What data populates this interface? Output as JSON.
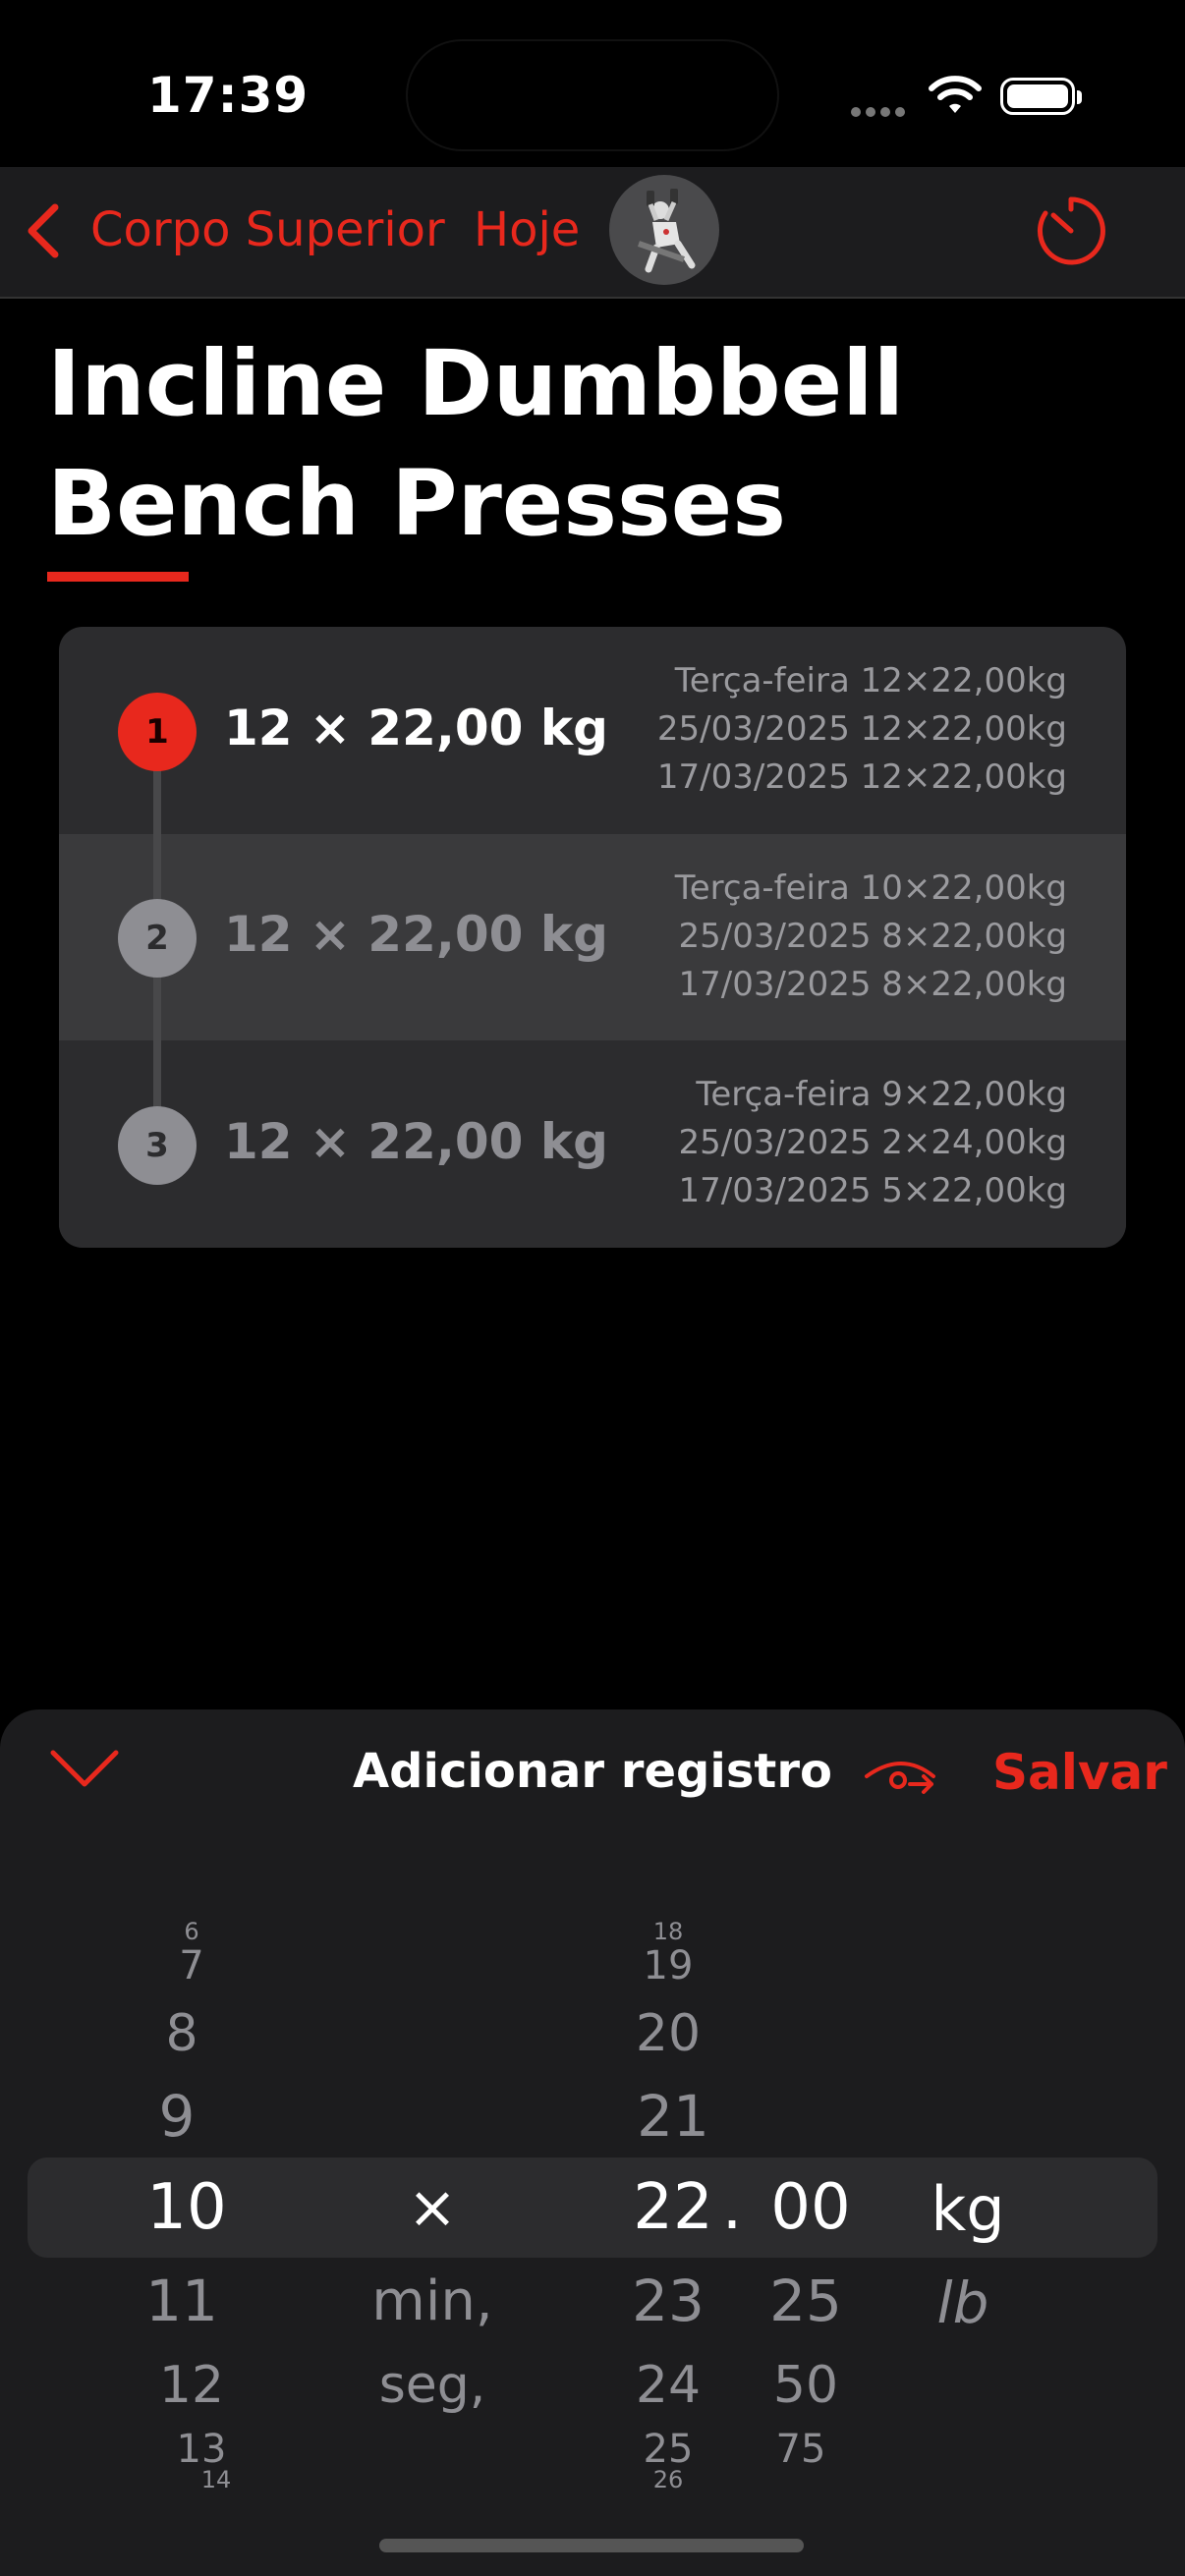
{
  "status_bar": {
    "time": "17:39"
  },
  "nav": {
    "back_label": "Corpo Superior",
    "today_label": "Hoje"
  },
  "exercise": {
    "title_line1": "Incline Dumbbell",
    "title_line2": "Bench Presses"
  },
  "colors": {
    "accent": "#e8281d",
    "background": "#000000",
    "card": "#2c2c2e",
    "sheet": "#1c1c1e"
  },
  "sets": [
    {
      "number": "1",
      "value": "12 × 22,00 kg",
      "active": true,
      "history": [
        "Terça-feira 12×22,00kg",
        "25/03/2025 12×22,00kg",
        "17/03/2025 12×22,00kg"
      ]
    },
    {
      "number": "2",
      "value": "12 × 22,00 kg",
      "active": false,
      "history": [
        "Terça-feira 10×22,00kg",
        "25/03/2025 8×22,00kg",
        "17/03/2025 8×22,00kg"
      ]
    },
    {
      "number": "3",
      "value": "12 × 22,00 kg",
      "active": false,
      "history": [
        "Terça-feira 9×22,00kg",
        "25/03/2025 2×24,00kg",
        "17/03/2025 5×22,00kg"
      ]
    }
  ],
  "sheet": {
    "title": "Adicionar registro",
    "save_label": "Salvar"
  },
  "picker": {
    "reps": {
      "above": [
        "6",
        "7",
        "8",
        "9"
      ],
      "selected": "10",
      "below": [
        "11",
        "12",
        "13",
        "14"
      ]
    },
    "mode": {
      "selected": "×",
      "below": [
        "min,",
        "seg,"
      ]
    },
    "weight_int": {
      "above": [
        "18",
        "19",
        "20",
        "21"
      ],
      "selected": "22",
      "below": [
        "23",
        "24",
        "25",
        "26"
      ]
    },
    "separator": ".",
    "weight_dec": {
      "selected": "00",
      "below": [
        "25",
        "50",
        "75"
      ]
    },
    "unit": {
      "selected": "kg",
      "below": [
        "lb"
      ]
    }
  },
  "icons": {
    "back": "chevron-left-icon",
    "timer": "timer-icon",
    "collapse": "chevron-down-icon",
    "repeat": "repeat-icon",
    "wifi": "wifi-icon",
    "battery": "battery-icon"
  }
}
